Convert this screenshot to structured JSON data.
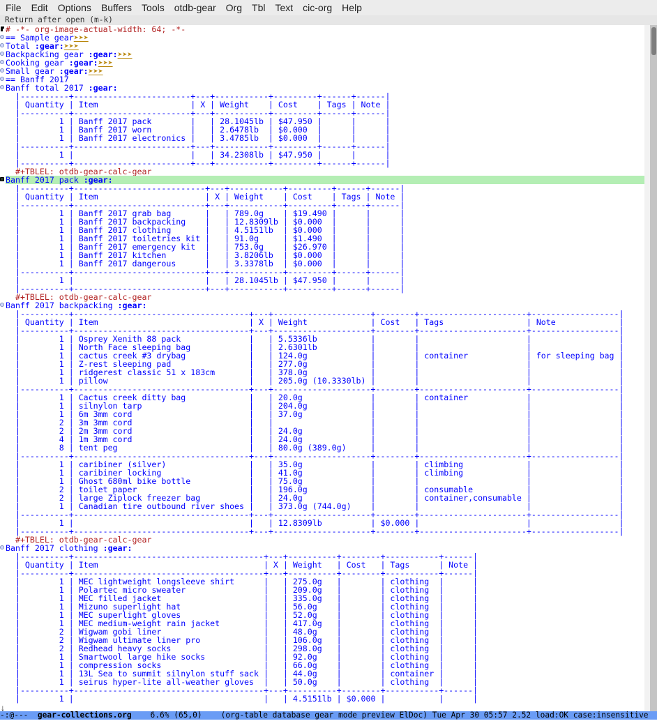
{
  "menubar": [
    "File",
    "Edit",
    "Options",
    "Buffers",
    "Tools",
    "otdb-gear",
    "Org",
    "Tbl",
    "Text",
    "cic-org",
    "Help"
  ],
  "header_line": "Return after open (m-k)",
  "file_comment": "# -*- org-image-actual-width: 64; -*-",
  "ellipsis": "➤➤➤",
  "outline": [
    {
      "text": "== Sample gear",
      "tag": "",
      "folded": true
    },
    {
      "text": "Total ",
      "tag": ":gear:",
      "folded": true
    },
    {
      "text": "Backpacking gear ",
      "tag": ":gear:",
      "folded": true
    },
    {
      "text": "Cooking gear ",
      "tag": ":gear:",
      "folded": true
    },
    {
      "text": "Small gear ",
      "tag": ":gear:",
      "folded": true
    },
    {
      "text": "== Banff 2017",
      "tag": "",
      "folded": false
    }
  ],
  "tblel": "#+TBLEL: otdb-gear-calc-gear",
  "columns": [
    "Quantity",
    "Item",
    "X",
    "Weight",
    "Cost",
    "Tags",
    "Note"
  ],
  "sections": [
    {
      "title": "Banff total 2017 ",
      "tag": ":gear:",
      "current": false,
      "groups": [
        [
          [
            "1",
            "Banff 2017 pack",
            "",
            "28.1045lb",
            "$47.950",
            "",
            ""
          ],
          [
            "1",
            "Banff 2017 worn",
            "",
            "2.6478lb",
            "$0.000",
            "",
            ""
          ],
          [
            "1",
            "Banff 2017 electronics",
            "",
            "3.4785lb",
            "$0.000",
            "",
            ""
          ]
        ]
      ],
      "total": [
        "1",
        "",
        "",
        "34.2308lb",
        "$47.950",
        "",
        ""
      ]
    },
    {
      "title": "Banff 2017 pack ",
      "tag": ":gear:",
      "current": true,
      "groups": [
        [
          [
            "1",
            "Banff 2017 grab bag",
            "",
            "789.0g",
            "$19.490",
            "",
            ""
          ],
          [
            "1",
            "Banff 2017 backpacking",
            "",
            "12.8309lb",
            "$0.000",
            "",
            ""
          ],
          [
            "1",
            "Banff 2017 clothing",
            "",
            "4.5151lb",
            "$0.000",
            "",
            ""
          ],
          [
            "1",
            "Banff 2017 toiletries kit",
            "",
            "91.0g",
            "$1.490",
            "",
            ""
          ],
          [
            "1",
            "Banff 2017 emergency kit",
            "",
            "753.0g",
            "$26.970",
            "",
            ""
          ],
          [
            "1",
            "Banff 2017 kitchen",
            "",
            "3.8206lb",
            "$0.000",
            "",
            ""
          ],
          [
            "1",
            "Banff 2017 dangerous",
            "",
            "3.3378lb",
            "$0.000",
            "",
            ""
          ]
        ]
      ],
      "total": [
        "1",
        "",
        "",
        "28.1045lb",
        "$47.950",
        "",
        ""
      ]
    },
    {
      "title": "Banff 2017 backpacking ",
      "tag": ":gear:",
      "current": false,
      "groups": [
        [
          [
            "1",
            "Osprey Xenith 88 pack",
            "",
            "5.5336lb",
            "",
            "",
            ""
          ],
          [
            "1",
            "North Face sleeping bag",
            "",
            "2.6301lb",
            "",
            "",
            ""
          ],
          [
            "1",
            "cactus creek #3 drybag",
            "",
            "124.0g",
            "",
            "container",
            "for sleeping bag"
          ],
          [
            "1",
            "Z-rest sleeping pad",
            "",
            "277.0g",
            "",
            "",
            ""
          ],
          [
            "1",
            "ridgerest classic 51 x 183cm",
            "",
            "378.0g",
            "",
            "",
            ""
          ],
          [
            "1",
            "pillow",
            "",
            "205.0g (10.3330lb)",
            "",
            "",
            ""
          ]
        ],
        [
          [
            "1",
            "Cactus creek ditty bag",
            "",
            "20.0g",
            "",
            "container",
            ""
          ],
          [
            "1",
            "silnylon tarp",
            "",
            "204.0g",
            "",
            "",
            ""
          ],
          [
            "1",
            "6m 3mm cord",
            "",
            "37.0g",
            "",
            "",
            ""
          ],
          [
            "2",
            "3m 3mm cord",
            "",
            "",
            "",
            "",
            ""
          ],
          [
            "2",
            "2m 3mm cord",
            "",
            "24.0g",
            "",
            "",
            ""
          ],
          [
            "4",
            "1m 3mm cord",
            "",
            "24.0g",
            "",
            "",
            ""
          ],
          [
            "8",
            "tent peg",
            "",
            "80.0g (389.0g)",
            "",
            "",
            ""
          ]
        ],
        [
          [
            "1",
            "caribiner (silver)",
            "",
            "35.0g",
            "",
            "climbing",
            ""
          ],
          [
            "1",
            "caribiner locking",
            "",
            "41.0g",
            "",
            "climbing",
            ""
          ],
          [
            "1",
            "Ghost 680ml bike bottle",
            "",
            "75.0g",
            "",
            "",
            ""
          ],
          [
            "2",
            "toilet paper",
            "",
            "196.0g",
            "",
            "consumable",
            ""
          ],
          [
            "2",
            "large Ziplock freezer bag",
            "",
            "24.0g",
            "",
            "container,consumable",
            ""
          ],
          [
            "1",
            "Canadian tire outbound river shoes",
            "",
            "373.0g (744.0g)",
            "",
            "",
            ""
          ]
        ]
      ],
      "total": [
        "1",
        "",
        "",
        "12.8309lb",
        "$0.000",
        "",
        ""
      ]
    },
    {
      "title": "Banff 2017 clothing ",
      "tag": ":gear:",
      "current": false,
      "groups": [
        [
          [
            "1",
            "MEC lightweight longsleeve shirt",
            "",
            "275.0g",
            "",
            "clothing",
            ""
          ],
          [
            "1",
            "Polartec micro sweater",
            "",
            "209.0g",
            "",
            "clothing",
            ""
          ],
          [
            "1",
            "MEC filled jacket",
            "",
            "335.0g",
            "",
            "clothing",
            ""
          ],
          [
            "1",
            "Mizuno superlight hat",
            "",
            "56.0g",
            "",
            "clothing",
            ""
          ],
          [
            "1",
            "MEC superlight gloves",
            "",
            "52.0g",
            "",
            "clothing",
            ""
          ],
          [
            "1",
            "MEC medium-weight rain jacket",
            "",
            "417.0g",
            "",
            "clothing",
            ""
          ],
          [
            "2",
            "Wigwam gobi liner",
            "",
            "48.0g",
            "",
            "clothing",
            ""
          ],
          [
            "2",
            "Wigwam ultimate liner pro",
            "",
            "106.0g",
            "",
            "clothing",
            ""
          ],
          [
            "2",
            "Redhead heavy socks",
            "",
            "298.0g",
            "",
            "clothing",
            ""
          ],
          [
            "1",
            "Smartwool large hike socks",
            "",
            "92.0g",
            "",
            "clothing",
            ""
          ],
          [
            "1",
            "compression socks",
            "",
            "66.0g",
            "",
            "clothing",
            ""
          ],
          [
            "1",
            "13L Sea to summit silnylon stuff sack",
            "",
            "44.0g",
            "",
            "container",
            ""
          ],
          [
            "1",
            "seirus hyper-lite all-weather gloves",
            "",
            "50.0g",
            "",
            "clothing",
            ""
          ]
        ]
      ],
      "total": [
        "1",
        "",
        "",
        "4.5151lb",
        "$0.000",
        "",
        ""
      ]
    }
  ],
  "modeline": {
    "status": "-:@---  ",
    "buffer_name": "gear-collections.org",
    "position": "    6.6% (65,0)    ",
    "modes": "(org-table database gear mode preview ElDoc)",
    "datetime": " Tue Apr 30 05:57",
    "load": " 2.52 load:OK case:insensitive"
  },
  "colors": {
    "heading": "#0000ff",
    "table": "#0000ff",
    "comment": "#b22222",
    "ellipsis": "#b8860b",
    "current_line": "#b4eeb4",
    "modeline": "#6a9cf5"
  }
}
